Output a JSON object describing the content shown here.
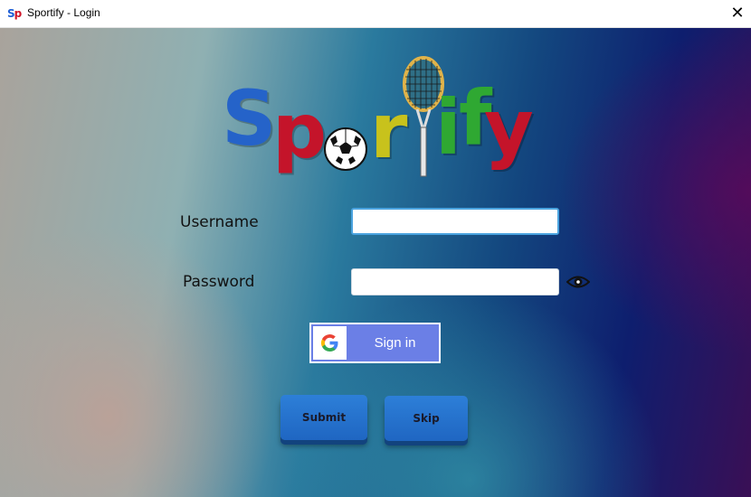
{
  "window": {
    "title": "Sportify - Login",
    "icon": "sp-app-icon",
    "icon_text_s": "S",
    "icon_text_p": "p",
    "close_symbol": "✕"
  },
  "logo": {
    "letters": [
      "S",
      "p",
      "o",
      "r",
      "t",
      "i",
      "f",
      "y"
    ]
  },
  "form": {
    "username_label": "Username",
    "username_value": "",
    "password_label": "Password",
    "password_value": ""
  },
  "google_signin": {
    "label": "Sign in",
    "icon": "google-g-icon"
  },
  "buttons": {
    "submit": "Submit",
    "skip": "Skip"
  },
  "colors": {
    "brand_blue": "#1f5fd6",
    "brand_red": "#d0152a",
    "button_blue": "#2d7fd8",
    "google_button": "#6b7fe6"
  }
}
